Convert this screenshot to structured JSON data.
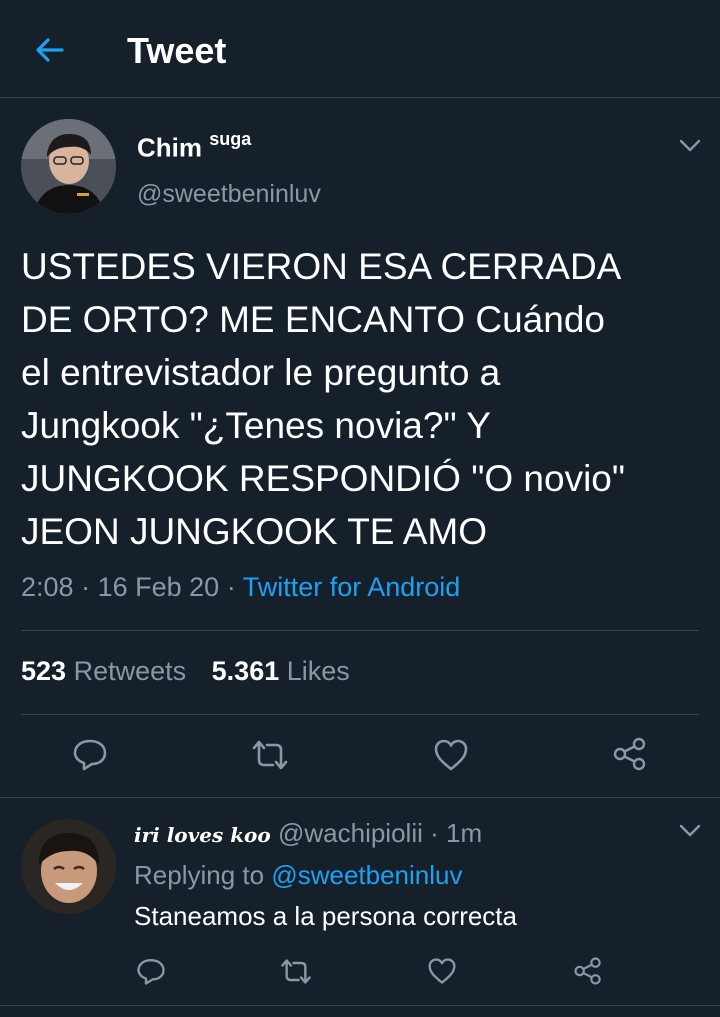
{
  "header": {
    "title": "Tweet"
  },
  "tweet": {
    "author_name": "Chim",
    "author_suffix": "suga",
    "author_handle": "@sweetbeninluv",
    "text": "USTEDES VIERON ESA CERRADA\nDE ORTO? ME ENCANTO Cuándo\nel entrevistador le pregunto a\nJungkook \"¿Tenes novia?\" Y\nJUNGKOOK RESPONDIÓ \"O novio\"\nJEON JUNGKOOK TE AMO",
    "time": "2:08",
    "date": "16 Feb 20",
    "source": "Twitter for Android",
    "retweets_count": "523",
    "retweets_label": "Retweets",
    "likes_count": "5.361",
    "likes_label": "Likes"
  },
  "reply": {
    "author_name": "iri loves koo",
    "author_handle": "@wachipiolii",
    "time": "1m",
    "replying_prefix": "Replying to",
    "replying_to": "@sweetbeninluv",
    "text": "Staneamos a la persona correcta"
  },
  "colors": {
    "background": "#15202b",
    "accent": "#1da1f2",
    "secondary_text": "#8899a6",
    "divider": "#38444d"
  },
  "icons": {
    "back": "arrow-left-icon",
    "menu": "chevron-down-icon",
    "reply": "reply-bubble-icon",
    "retweet": "retweet-icon",
    "like": "heart-icon",
    "share": "share-icon"
  }
}
